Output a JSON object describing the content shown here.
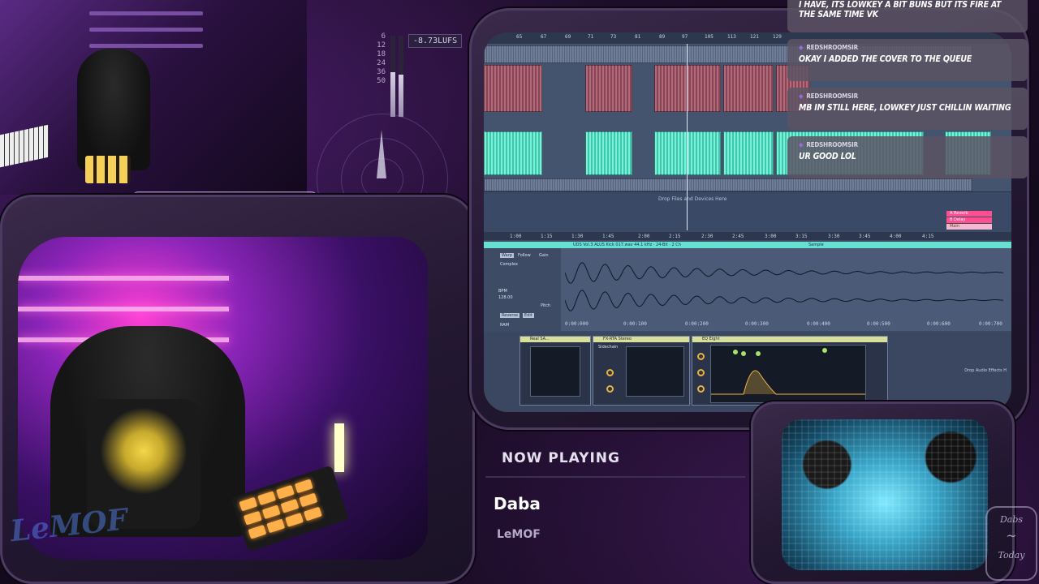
{
  "meter": {
    "lufs": "-8.73LUFS",
    "scale": [
      "6",
      "12",
      "18",
      "24",
      "36",
      "50"
    ],
    "level": 0.55
  },
  "chat": {
    "messages": [
      {
        "user": "",
        "text": "I HAVE, ITS LOWKEY A BIT BUNS BUT ITS FIRE AT THE SAME TIME VK"
      },
      {
        "user": "REDSHROOMSIR",
        "text": "OKAY I ADDED THE COVER TO THE QUEUE"
      },
      {
        "user": "REDSHROOMSIR",
        "text": "MB IM STILL HERE, LOWKEY JUST CHILLIN WAITING"
      },
      {
        "user": "REDSHROOMSIR",
        "text": "UR GOOD LOL"
      }
    ]
  },
  "daw": {
    "ruler": [
      "65",
      "67",
      "69",
      "71",
      "73",
      "81",
      "89",
      "97",
      "105",
      "113",
      "121",
      "129"
    ],
    "timeline": [
      "1:00",
      "1:15",
      "1:30",
      "1:45",
      "2:00",
      "2:15",
      "2:30",
      "2:45",
      "3:00",
      "3:15",
      "3:30",
      "3:45",
      "4:00",
      "4:15"
    ],
    "drop_text": "Drop Files and Devices Here",
    "clip_title": "UDS Vol.3 ALUS Kick 017.wav  44.1 kHz · 24-Bit · 2 Ch",
    "sample_tab": "Sample",
    "warp": "Warp",
    "follow": "Follow",
    "mode": "Complex",
    "bpm_label": "BPM",
    "bpm": "128.00",
    "reverse": "Reverse",
    "edit": "Edit",
    "ram": "RAM",
    "gain_label": "Gain",
    "pitch_label": "Pitch",
    "sample_times": [
      "0:00:000",
      "0:00:100",
      "0:00:200",
      "0:00:300",
      "0:00:400",
      "0:00:500",
      "0:00:600",
      "0:00:700"
    ],
    "device1": "Real SA...",
    "device2": "FX-RTA Stereo",
    "device3": "EQ Eight",
    "sidechain": "Sidechain",
    "drop_effects": "Drop Audio Effects H",
    "returns": [
      "A Reverb",
      "B Delay",
      "Main"
    ]
  },
  "now_playing": {
    "label": "NOW PLAYING",
    "title": "Daba",
    "artist": "LeMOF"
  },
  "logos": {
    "lemof": "LeMOF",
    "dabs_top": "Dabs",
    "dabs_bottom": "Today"
  },
  "colors": {
    "accent": "#67e0d2",
    "clip_red": "#b06a78",
    "chat_bg": "#5a5464"
  }
}
